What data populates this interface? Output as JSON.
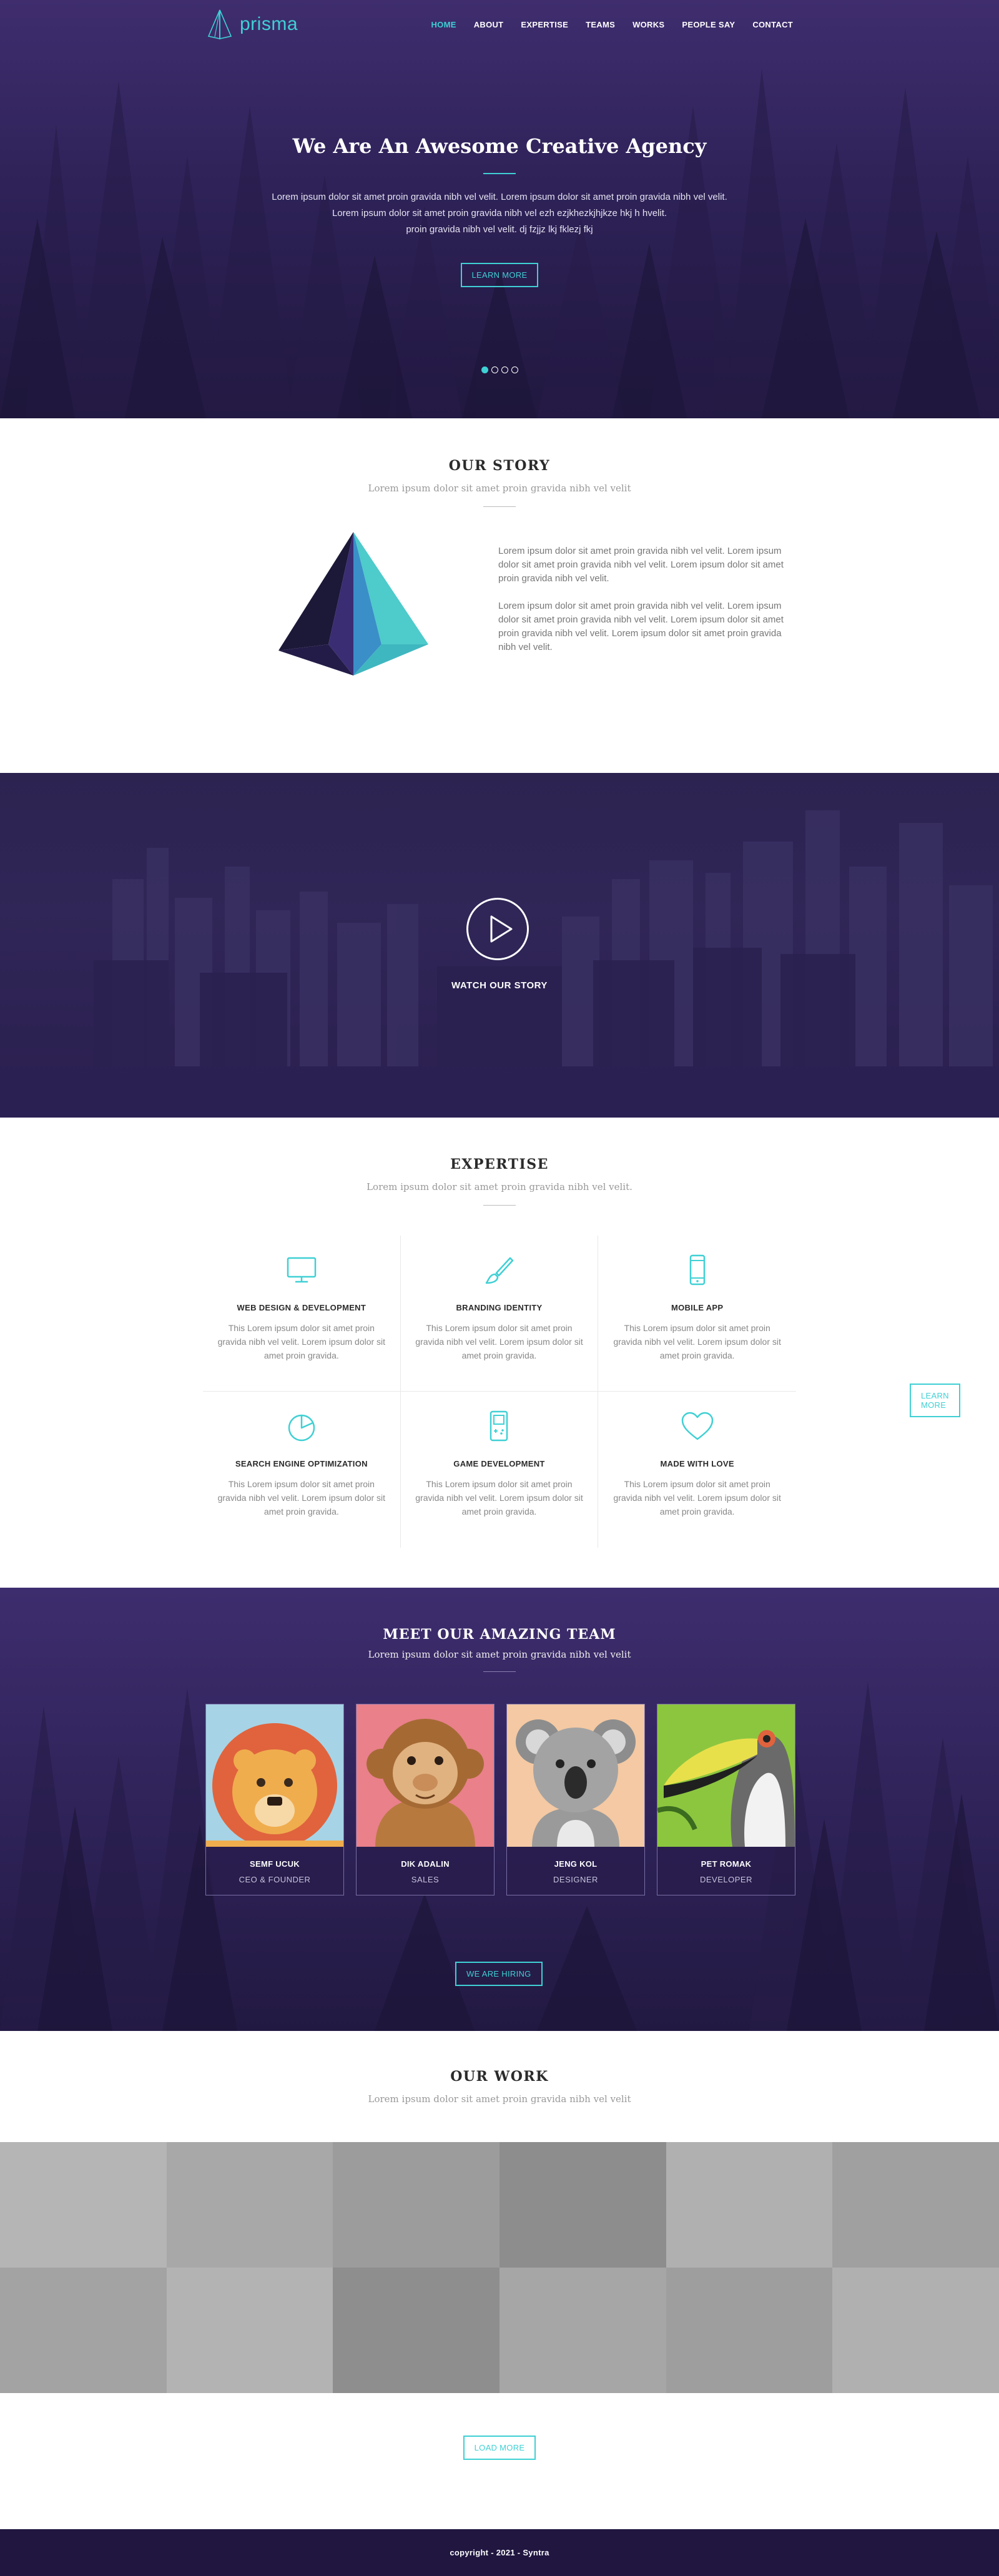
{
  "brand": {
    "name": "prisma",
    "accent": "#3fd0d4",
    "dark": "#2e2258"
  },
  "nav": {
    "items": [
      {
        "label": "HOME",
        "active": true
      },
      {
        "label": "ABOUT"
      },
      {
        "label": "EXPERTISE"
      },
      {
        "label": "TEAMS"
      },
      {
        "label": "WORKS"
      },
      {
        "label": "PEOPLE SAY"
      },
      {
        "label": "CONTACT"
      }
    ]
  },
  "hero": {
    "title": "We Are An Awesome Creative Agency",
    "lines": [
      "Lorem ipsum dolor sit amet proin gravida nibh vel velit. Lorem ipsum dolor sit amet proin gravida nibh vel velit.",
      "Lorem ipsum dolor sit amet proin gravida nibh vel ezh ezjkhezkjhjkze hkj h hvelit.",
      "proin gravida nibh vel velit. dj fzjjz lkj fklezj fkj"
    ],
    "button": "LEARN MORE",
    "slides": 4,
    "active_slide": 1
  },
  "story": {
    "title": "OUR STORY",
    "subtitle": "Lorem ipsum dolor sit amet proin gravida nibh vel velit",
    "paragraphs": [
      "Lorem ipsum dolor sit amet proin gravida nibh vel velit. Lorem ipsum dolor sit amet proin gravida nibh vel velit. Lorem ipsum dolor sit amet proin gravida nibh vel velit.",
      "Lorem ipsum dolor sit amet proin gravida nibh vel velit. Lorem ipsum dolor sit amet proin gravida nibh vel velit. Lorem ipsum dolor sit amet proin gravida nibh vel velit. Lorem ipsum dolor sit amet proin gravida nibh vel velit."
    ],
    "button": "LEARN MORE"
  },
  "video": {
    "label": "WATCH OUR STORY"
  },
  "expertise": {
    "title": "EXPERTISE",
    "subtitle": "Lorem ipsum dolor sit amet proin gravida nibh vel velit.",
    "items": [
      {
        "icon": "monitor-icon",
        "title": "WEB DESIGN & DEVELOPMENT",
        "text": "This Lorem ipsum dolor sit amet proin gravida nibh vel velit. Lorem ipsum dolor sit amet proin gravida."
      },
      {
        "icon": "brush-icon",
        "title": "BRANDING IDENTITY",
        "text": "This Lorem ipsum dolor sit amet proin gravida nibh vel velit. Lorem ipsum dolor sit amet proin gravida."
      },
      {
        "icon": "smartphone-icon",
        "title": "MOBILE APP",
        "text": "This Lorem ipsum dolor sit amet proin gravida nibh vel velit. Lorem ipsum dolor sit amet proin gravida."
      },
      {
        "icon": "pie-chart-icon",
        "title": "SEARCH ENGINE OPTIMIZATION",
        "text": "This Lorem ipsum dolor sit amet proin gravida nibh vel velit. Lorem ipsum dolor sit amet proin gravida."
      },
      {
        "icon": "gameboy-icon",
        "title": "GAME DEVELOPMENT",
        "text": "This Lorem ipsum dolor sit amet proin gravida nibh vel velit. Lorem ipsum dolor sit amet proin gravida."
      },
      {
        "icon": "heart-icon",
        "title": "MADE WITH LOVE",
        "text": "This Lorem ipsum dolor sit amet proin gravida nibh vel velit. Lorem ipsum dolor sit amet proin gravida."
      }
    ]
  },
  "team": {
    "title": "MEET OUR AMAZING TEAM",
    "subtitle": "Lorem ipsum dolor sit amet proin gravida nibh vel velit",
    "members": [
      {
        "name": "SEMF UCUK",
        "role": "CEO & FOUNDER",
        "avatar": "lion-icon"
      },
      {
        "name": "DIK ADALIN",
        "role": "SALES",
        "avatar": "monkey-icon"
      },
      {
        "name": "JENG KOL",
        "role": "DESIGNER",
        "avatar": "koala-icon"
      },
      {
        "name": "PET ROMAK",
        "role": "DEVELOPER",
        "avatar": "toucan-icon"
      }
    ],
    "button": "WE ARE HIRING"
  },
  "work": {
    "title": "OUR WORK",
    "subtitle": "Lorem ipsum dolor sit amet proin gravida nibh vel velit",
    "tile_colors": [
      "#b5b5b5",
      "#a8a8a8",
      "#9c9c9c",
      "#8d8d8d",
      "#b0b0b0",
      "#a0a0a0",
      "#a3a3a3",
      "#b3b3b3",
      "#8e8e8e",
      "#a6a6a6",
      "#9e9e9e",
      "#b0b0b0"
    ],
    "button": "LOAD MORE"
  },
  "footer": {
    "copyright": "copyright - 2021 - Syntra"
  }
}
